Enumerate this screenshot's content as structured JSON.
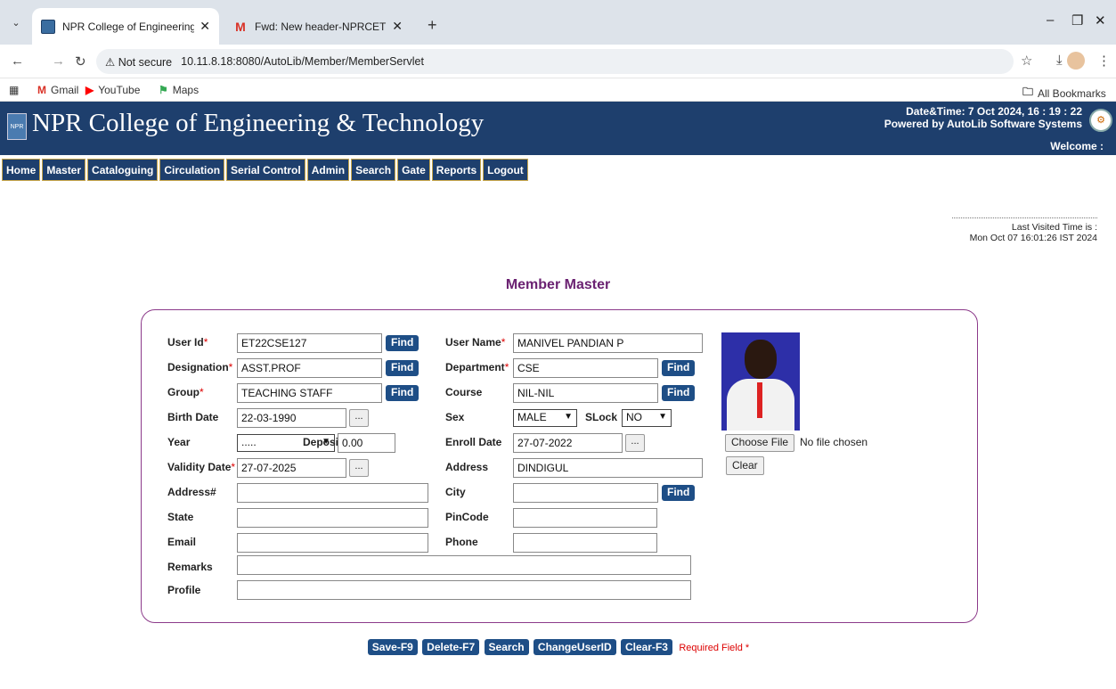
{
  "browser": {
    "tabs": [
      {
        "title": "NPR College of Engineering & T",
        "active": true
      },
      {
        "title": "Fwd: New header-NPRCET - bar",
        "active": false
      }
    ],
    "url": "10.11.8.18:8080/AutoLib/Member/MemberServlet",
    "security": "Not secure",
    "bookmarks": [
      "Gmail",
      "YouTube",
      "Maps"
    ],
    "all_bookmarks": "All Bookmarks"
  },
  "header": {
    "college_name": "NPR College of Engineering & Technology",
    "datetime": "Date&Time:  7 Oct 2024, 16 : 19 : 22",
    "powered_by": "Powered by AutoLib Software Systems",
    "welcome": "Welcome   :"
  },
  "menu": [
    "Home",
    "Master",
    "Cataloguing",
    "Circulation",
    "Serial Control",
    "Admin",
    "Search",
    "Gate",
    "Reports",
    "Logout"
  ],
  "last_visited": {
    "label": "Last Visited Time is :",
    "value": "Mon Oct 07 16:01:26 IST 2024"
  },
  "page_title": "Member Master",
  "form": {
    "user_id": {
      "label": "User Id",
      "value": "ET22CSE127"
    },
    "designation": {
      "label": "Designation",
      "value": "ASST.PROF"
    },
    "group": {
      "label": "Group",
      "value": "TEACHING STAFF"
    },
    "birth_date": {
      "label": "Birth Date",
      "value": "22-03-1990"
    },
    "year": {
      "label": "Year",
      "value": "....."
    },
    "deposit": {
      "label": "Deposit",
      "value": "0.00"
    },
    "validity_date": {
      "label": "Validity Date",
      "value": "27-07-2025"
    },
    "address2": {
      "label": "Address#",
      "value": ""
    },
    "state": {
      "label": "State",
      "value": ""
    },
    "email": {
      "label": "Email",
      "value": ""
    },
    "remarks": {
      "label": "Remarks",
      "value": ""
    },
    "profile": {
      "label": "Profile",
      "value": ""
    },
    "user_name": {
      "label": "User Name",
      "value": "MANIVEL PANDIAN P"
    },
    "department": {
      "label": "Department",
      "value": "CSE"
    },
    "course": {
      "label": "Course",
      "value": "NIL-NIL"
    },
    "sex": {
      "label": "Sex",
      "value": "MALE"
    },
    "slock": {
      "label": "SLock",
      "value": "NO"
    },
    "enroll_date": {
      "label": "Enroll Date",
      "value": "27-07-2022"
    },
    "address": {
      "label": "Address",
      "value": "DINDIGUL"
    },
    "city": {
      "label": "City",
      "value": ""
    },
    "pincode": {
      "label": "PinCode",
      "value": ""
    },
    "phone": {
      "label": "Phone",
      "value": ""
    },
    "find_label": "Find",
    "cal_label": "...",
    "required_mark": "*"
  },
  "photo": {
    "choose_file": "Choose File",
    "no_file": "No file chosen",
    "clear": "Clear"
  },
  "actions": {
    "save": "Save-F9",
    "delete": "Delete-F7",
    "search": "Search",
    "change_user_id": "ChangeUserID",
    "clear": "Clear-F3",
    "required_note": "Required Field *"
  }
}
